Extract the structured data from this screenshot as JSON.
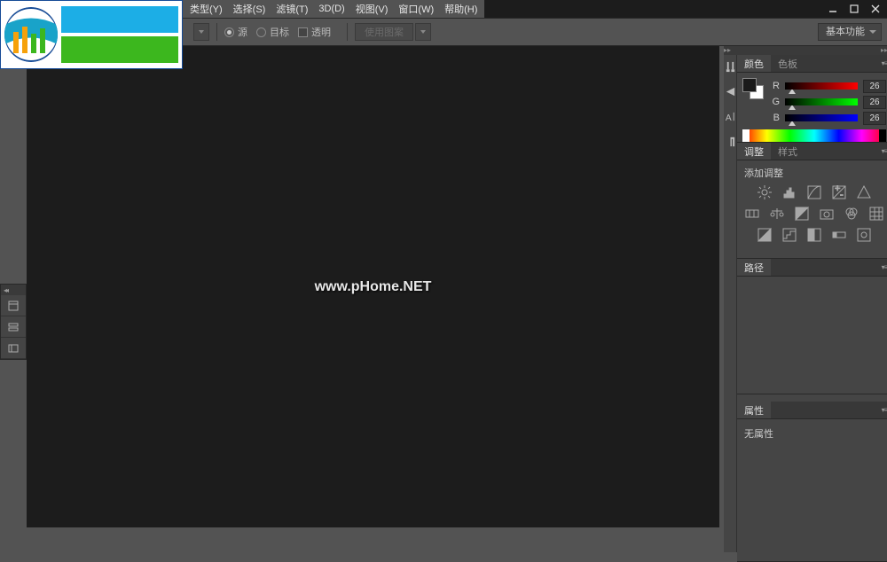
{
  "menu": [
    "类型(Y)",
    "选择(S)",
    "滤镜(T)",
    "3D(D)",
    "视图(V)",
    "窗口(W)",
    "帮助(H)"
  ],
  "options": {
    "source": "源",
    "dest": "目标",
    "transparent": "透明",
    "use_pattern": "使用图案",
    "workspace": "基本功能"
  },
  "watermark": "www.pHome.NET",
  "color_panel": {
    "tab_color": "颜色",
    "tab_swatches": "色板",
    "r": {
      "label": "R",
      "value": "26",
      "pct": 10
    },
    "g": {
      "label": "G",
      "value": "26",
      "pct": 10
    },
    "b": {
      "label": "B",
      "value": "26",
      "pct": 10
    }
  },
  "adjustments": {
    "tab_adj": "调整",
    "tab_styles": "样式",
    "title": "添加调整"
  },
  "paths": {
    "tab": "路径"
  },
  "properties": {
    "tab": "属性",
    "empty": "无属性"
  }
}
